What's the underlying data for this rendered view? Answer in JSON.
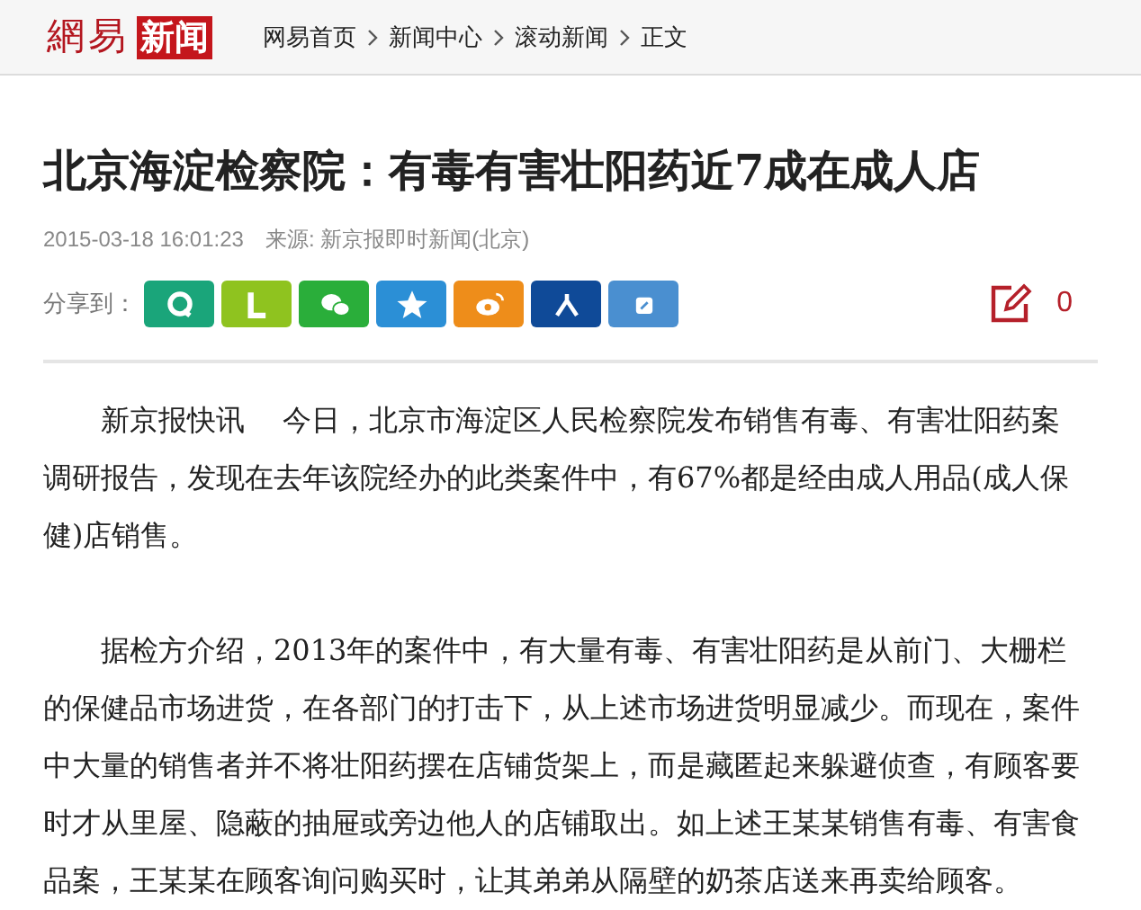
{
  "logo": {
    "brand": "網易",
    "section": "新闻"
  },
  "breadcrumb": [
    "网易首页",
    "新闻中心",
    "滚动新闻",
    "正文"
  ],
  "article": {
    "title": "北京海淀检察院：有毒有害壮阳药近7成在成人店",
    "time": "2015-03-18 16:01:23",
    "source": "来源: 新京报即时新闻(北京)"
  },
  "share": {
    "label": "分享到：",
    "buttons": [
      {
        "kind": "qq",
        "color": "#1aa57a"
      },
      {
        "kind": "laiwang",
        "color": "#8fc31f"
      },
      {
        "kind": "wechat",
        "color": "#2aae3a"
      },
      {
        "kind": "qzone",
        "color": "#2b8fd6"
      },
      {
        "kind": "weibo",
        "color": "#ee8d1a"
      },
      {
        "kind": "renren",
        "color": "#0f4a98"
      },
      {
        "kind": "note",
        "color": "#4a8fd0"
      }
    ]
  },
  "comment_count": "0",
  "paragraphs": [
    "新京报快讯　 今日，北京市海淀区人民检察院发布销售有毒、有害壮阳药案调研报告，发现在去年该院经办的此类案件中，有67%都是经由成人用品(成人保健)店销售。",
    "据检方介绍，2013年的案件中，有大量有毒、有害壮阳药是从前门、大栅栏的保健品市场进货，在各部门的打击下，从上述市场进货明显减少。而现在，案件中大量的销售者并不将壮阳药摆在店铺货架上，而是藏匿起来躲避侦查，有顾客要时才从里屋、隐蔽的抽屉或旁边他人的店铺取出。如上述王某某销售有毒、有害食品案，王某某在顾客询问购买时，让其弟弟从隔壁的奶茶店送来再卖给顾客。"
  ]
}
